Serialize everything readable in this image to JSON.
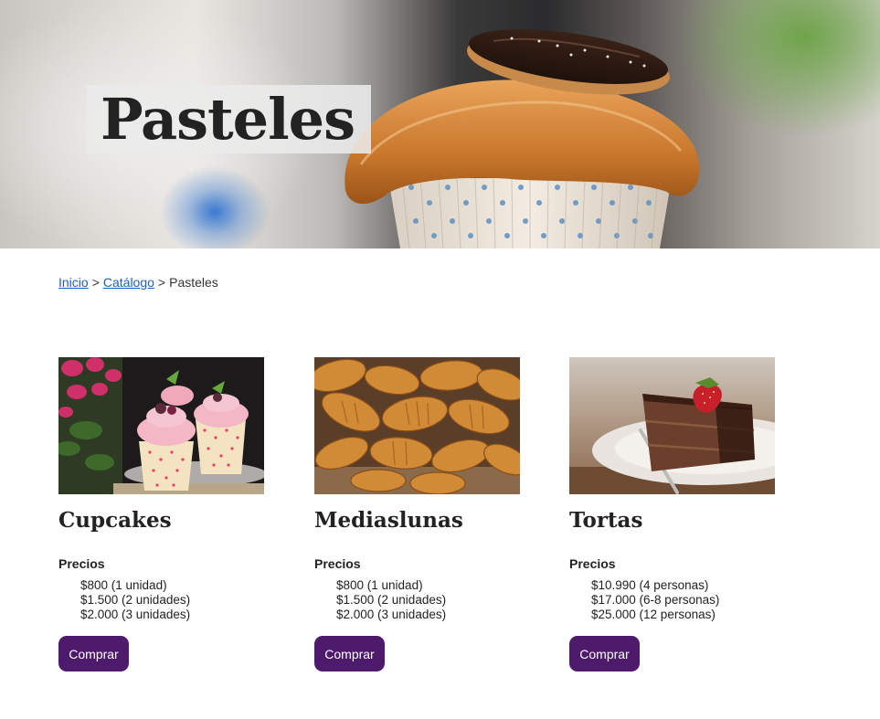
{
  "hero": {
    "title": "Pasteles"
  },
  "breadcrumb": {
    "items": [
      {
        "label": "Inicio",
        "link": true
      },
      {
        "label": "Catálogo",
        "link": true
      },
      {
        "label": "Pasteles",
        "link": false
      }
    ],
    "separator": ">"
  },
  "products": [
    {
      "title": "Cupcakes",
      "image_icon": "cupcakes-photo",
      "prices_heading": "Precios",
      "prices": [
        "$800 (1 unidad)",
        "$1.500 (2 unidades)",
        "$2.000 (3 unidades)"
      ],
      "button_label": "Comprar"
    },
    {
      "title": "Mediaslunas",
      "image_icon": "croissants-photo",
      "prices_heading": "Precios",
      "prices": [
        "$800 (1 unidad)",
        "$1.500 (2 unidades)",
        "$2.000 (3 unidades)"
      ],
      "button_label": "Comprar"
    },
    {
      "title": "Tortas",
      "image_icon": "cake-slice-photo",
      "prices_heading": "Precios",
      "prices": [
        "$10.990 (4 personas)",
        "$17.000 (6-8 personas)",
        "$25.000 (12 personas)"
      ],
      "button_label": "Comprar"
    }
  ],
  "colors": {
    "link": "#1a5fc4",
    "button_bg": "#4e1a6b",
    "button_text": "#ffffff"
  }
}
